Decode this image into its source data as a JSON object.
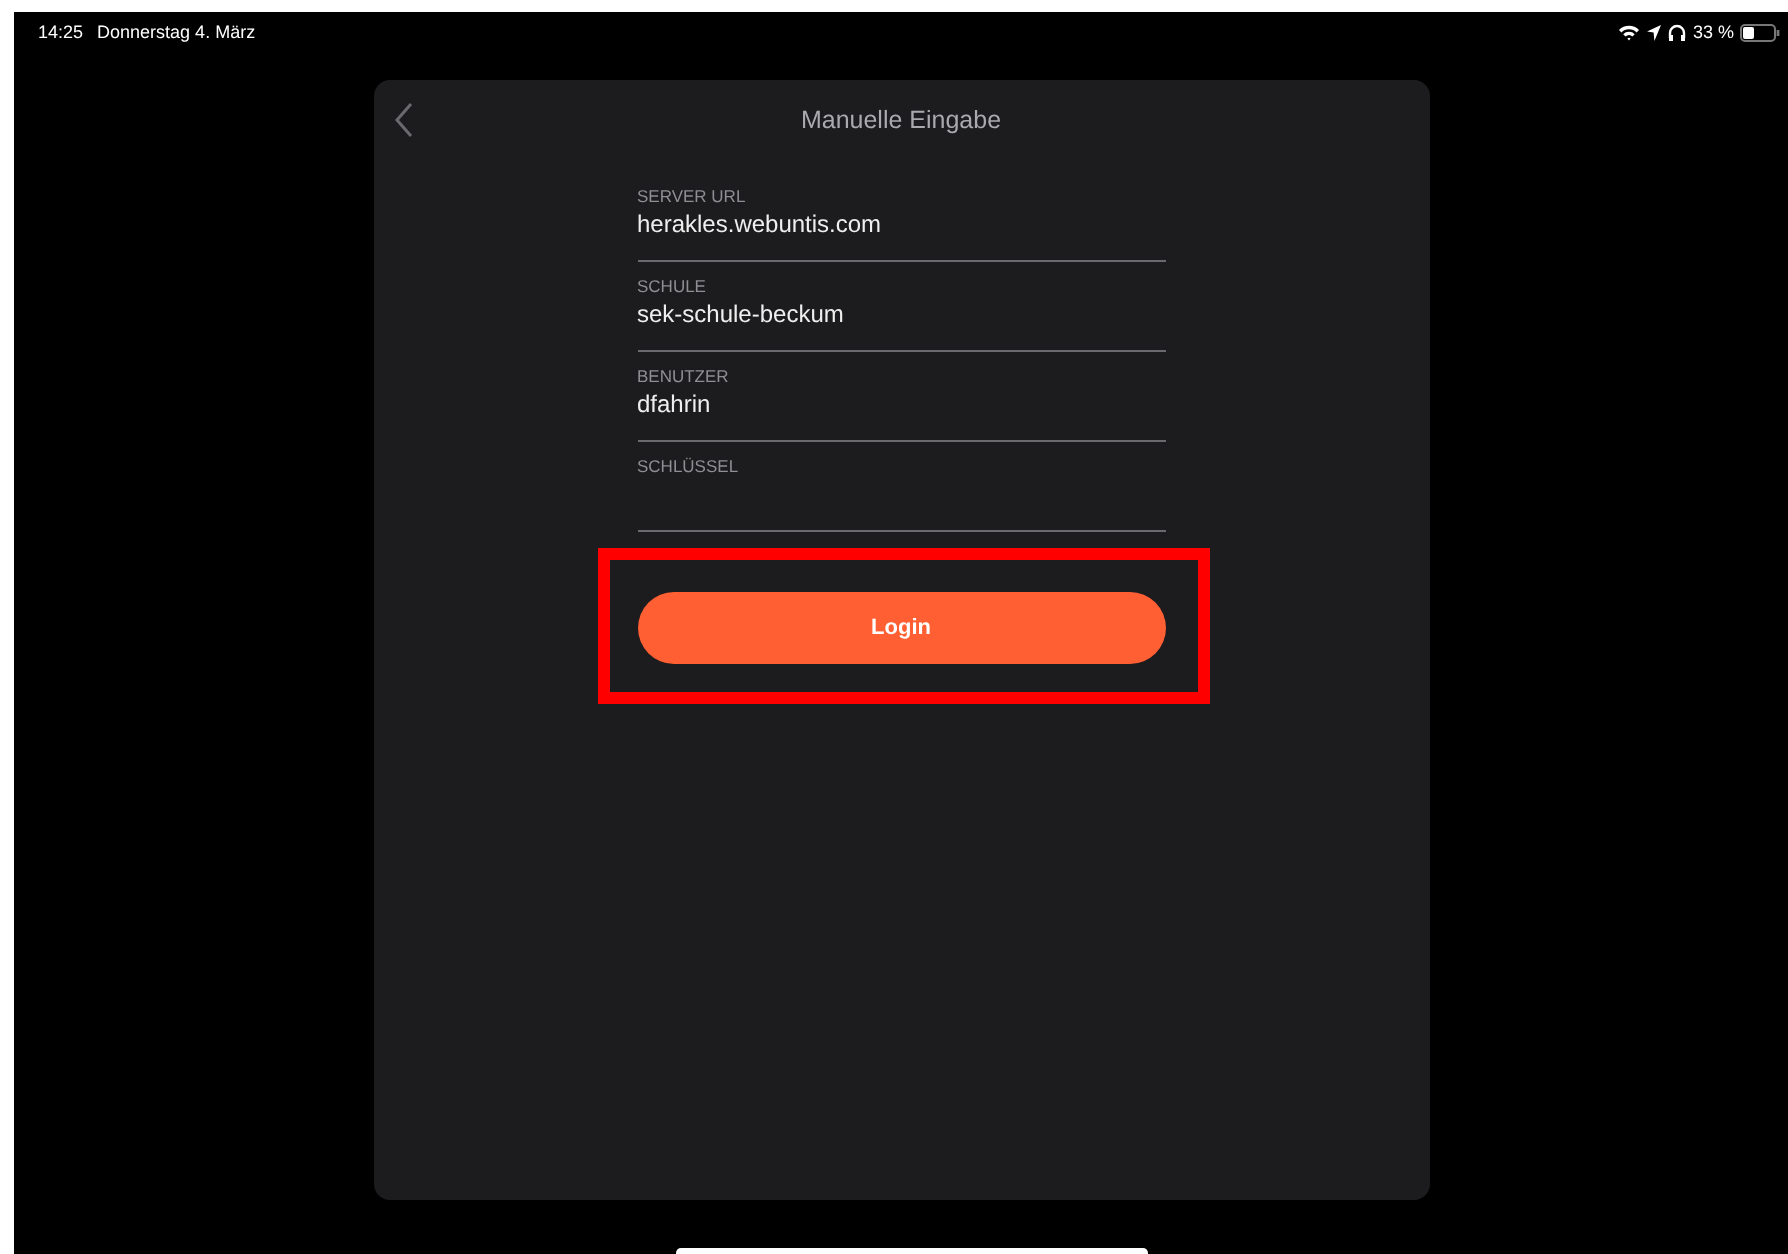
{
  "status_bar": {
    "time": "14:25",
    "date": "Donnerstag 4. März",
    "battery_text": "33 %"
  },
  "dialog": {
    "title": "Manuelle Eingabe",
    "fields": [
      {
        "label": "SERVER URL",
        "value": "herakles.webuntis.com"
      },
      {
        "label": "SCHULE",
        "value": "sek-schule-beckum"
      },
      {
        "label": "BENUTZER",
        "value": "dfahrin"
      },
      {
        "label": "SCHLÜSSEL"
      }
    ],
    "login_button": {
      "label": "Login",
      "highlighted": true
    }
  }
}
